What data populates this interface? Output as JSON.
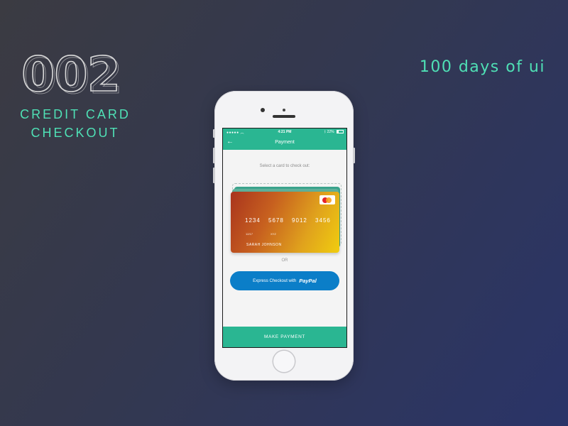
{
  "header": {
    "number": "002",
    "subtitle_line1": "CREDIT CARD",
    "subtitle_line2": "CHECKOUT",
    "series": "100 days of ui"
  },
  "colors": {
    "accent": "#4fe0b5",
    "app_green": "#2ab692",
    "paypal_blue": "#0b7ec8"
  },
  "phone": {
    "status": {
      "time": "4:21 PM",
      "battery": "22%",
      "signal_icon": "signal-wifi-icon"
    },
    "nav": {
      "back_icon": "arrow-left-icon",
      "title": "Payment"
    },
    "prompt": "Select a card to check out:",
    "card": {
      "number": "1234 5678 9012 3456",
      "expiry": "12/17",
      "cvc_label": "XYZ",
      "holder": "SARAH JOHNSON",
      "brand_icon": "mastercard-icon"
    },
    "or_text": "OR",
    "paypal": {
      "label": "Express Checkout with",
      "brand": "PayPal"
    },
    "make_payment": "MAKE PAYMENT"
  }
}
